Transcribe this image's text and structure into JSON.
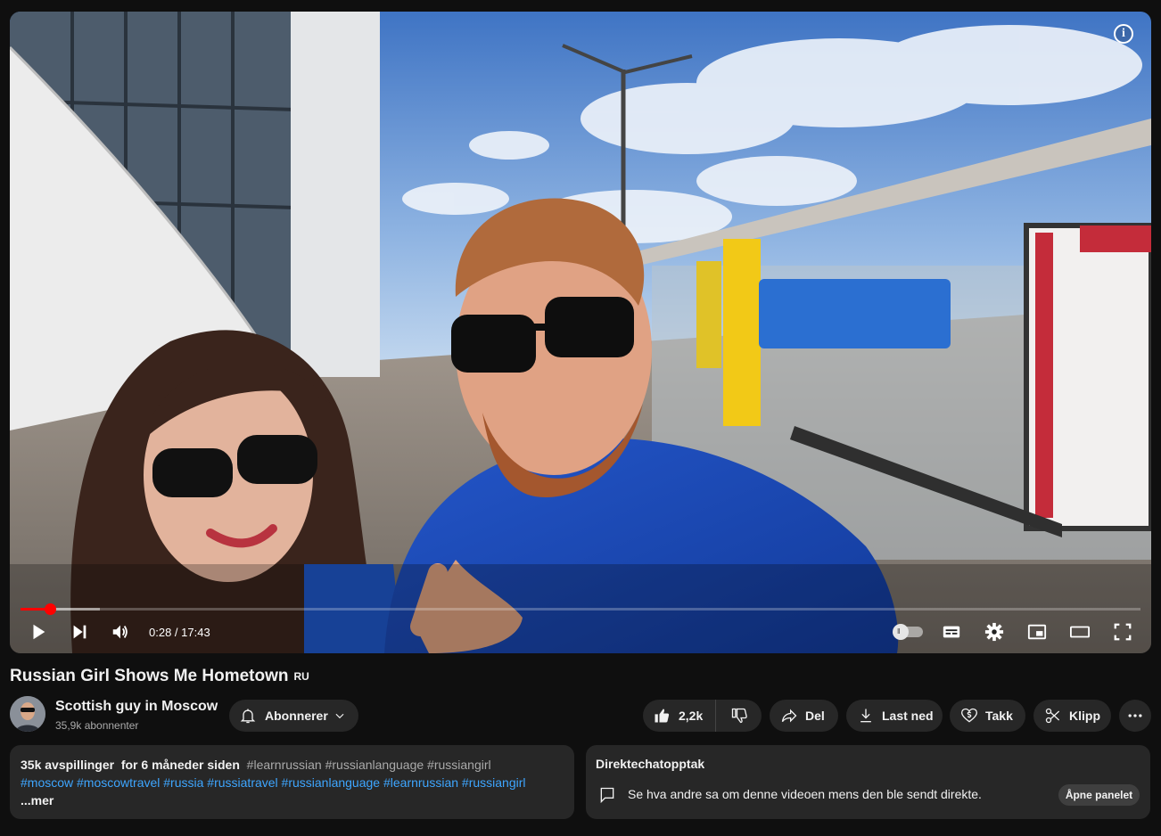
{
  "player": {
    "info_icon": "info-icon",
    "progress": {
      "current_seconds": 28,
      "duration_seconds": 1063,
      "buffered_seconds": 75
    },
    "time_label": "0:28 / 17:43",
    "controls_left": [
      "play-icon",
      "next-icon",
      "volume-icon"
    ],
    "controls_right": [
      "autoplay-toggle-icon",
      "subtitles-icon",
      "settings-icon",
      "miniplayer-icon",
      "theater-mode-icon",
      "fullscreen-icon"
    ],
    "accent_color": "#ff0000"
  },
  "video": {
    "title": "Russian Girl Shows Me Hometown",
    "lang_badge": "RU"
  },
  "channel": {
    "name": "Scottish guy in Moscow",
    "subscribers": "35,9k abonnenter"
  },
  "actions": {
    "subscribe_label": "Abonnerer",
    "like_count": "2,2k",
    "share_label": "Del",
    "download_label": "Last ned",
    "thanks_label": "Takk",
    "clip_label": "Klipp"
  },
  "description": {
    "views": "35k avspillinger",
    "age": "for 6 måneder siden",
    "inline_tags": "#learnrussian #russianlanguage #russiangirl",
    "hashtags": "#moscow #moscowtravel #russia #russiatravel #russianlanguage #learnrussian #russiangirl",
    "more_label": "...mer"
  },
  "chat_replay": {
    "title": "Direktechatopptak",
    "text": "Se hva andre sa om denne videoen mens den ble sendt direkte.",
    "button_label": "Åpne panelet"
  },
  "colors": {
    "background": "#0f0f0f",
    "surface": "#272727",
    "link": "#3ea6ff"
  }
}
